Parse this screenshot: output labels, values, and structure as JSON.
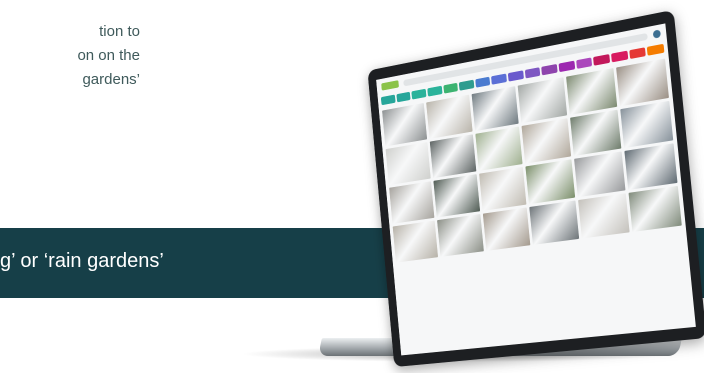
{
  "intro_lines": [
    "tion to",
    "on on the",
    "gardens’"
  ],
  "band": {
    "text": "g’ or ‘rain gardens’",
    "color": "#163f48"
  },
  "laptop": {
    "chip_colors": [
      "#26a69a",
      "#26a69a",
      "#2bb39b",
      "#2bb39b",
      "#3cb371",
      "#2e9c8f",
      "#4a7bd0",
      "#5b6fd6",
      "#6a5acd",
      "#7e57c2",
      "#8e44ad",
      "#9c27b0",
      "#ab47bc",
      "#c2185b",
      "#d81b60",
      "#e53935",
      "#f57c00"
    ],
    "tile_colors": [
      "#8d9192",
      "#b9b4aa",
      "#6f7a80",
      "#a2a7a4",
      "#7c8a70",
      "#9a8f84",
      "#cfd0cd",
      "#5d6463",
      "#9fb08f",
      "#b0a79a",
      "#6e7c6b",
      "#86919a",
      "#a6a39d",
      "#4f5b53",
      "#c0bbb1",
      "#7b8f6a",
      "#97999b",
      "#5f6a72",
      "#b7b2a8",
      "#8b8f86",
      "#a49a8e",
      "#6d7478",
      "#c4c1bb",
      "#7f8a7a"
    ]
  }
}
